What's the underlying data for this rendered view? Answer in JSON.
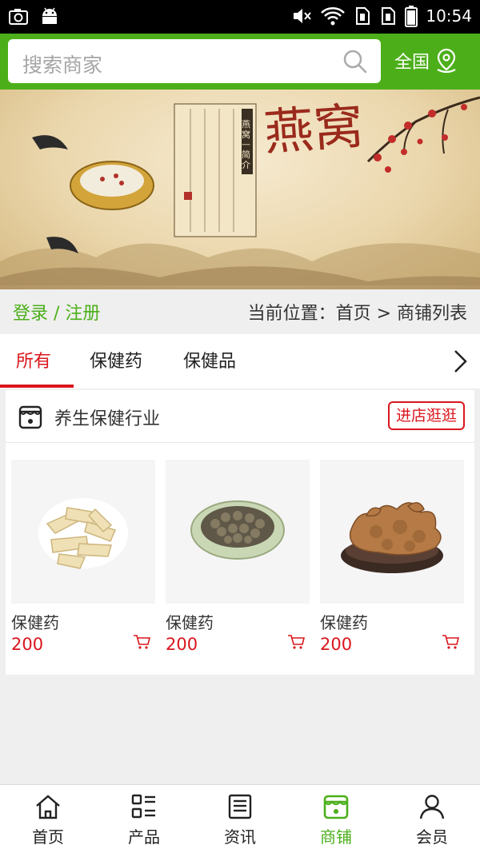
{
  "status_bar": {
    "time": "10:54"
  },
  "header": {
    "search": {
      "placeholder": "搜索商家"
    },
    "region_label": "全国",
    "accent_color": "#4caf1a"
  },
  "banner": {
    "title": "燕窝",
    "intro_heading": "燕窝—简介"
  },
  "location_bar": {
    "login_label": "登录 / 注册",
    "breadcrumb": "当前位置：首页 > 商铺列表"
  },
  "tabs": [
    {
      "label": "所有",
      "active": true
    },
    {
      "label": "保健药",
      "active": false
    },
    {
      "label": "保健品",
      "active": false
    }
  ],
  "shop": {
    "name": "养生保健行业",
    "visit_label": "进店逛逛",
    "products": [
      {
        "name": "保健药",
        "price": "200",
        "image": "sliced-root"
      },
      {
        "name": "保健药",
        "price": "200",
        "image": "seeds-bowl"
      },
      {
        "name": "保健药",
        "price": "200",
        "image": "ginseng-plate"
      }
    ]
  },
  "bottom_nav": [
    {
      "label": "首页",
      "icon": "home-icon",
      "active": false
    },
    {
      "label": "产品",
      "icon": "grid-list-icon",
      "active": false
    },
    {
      "label": "资讯",
      "icon": "news-icon",
      "active": false
    },
    {
      "label": "商铺",
      "icon": "store-icon",
      "active": true
    },
    {
      "label": "会员",
      "icon": "user-icon",
      "active": false
    }
  ],
  "colors": {
    "accent": "#4caf1a",
    "price": "#d9161c"
  }
}
